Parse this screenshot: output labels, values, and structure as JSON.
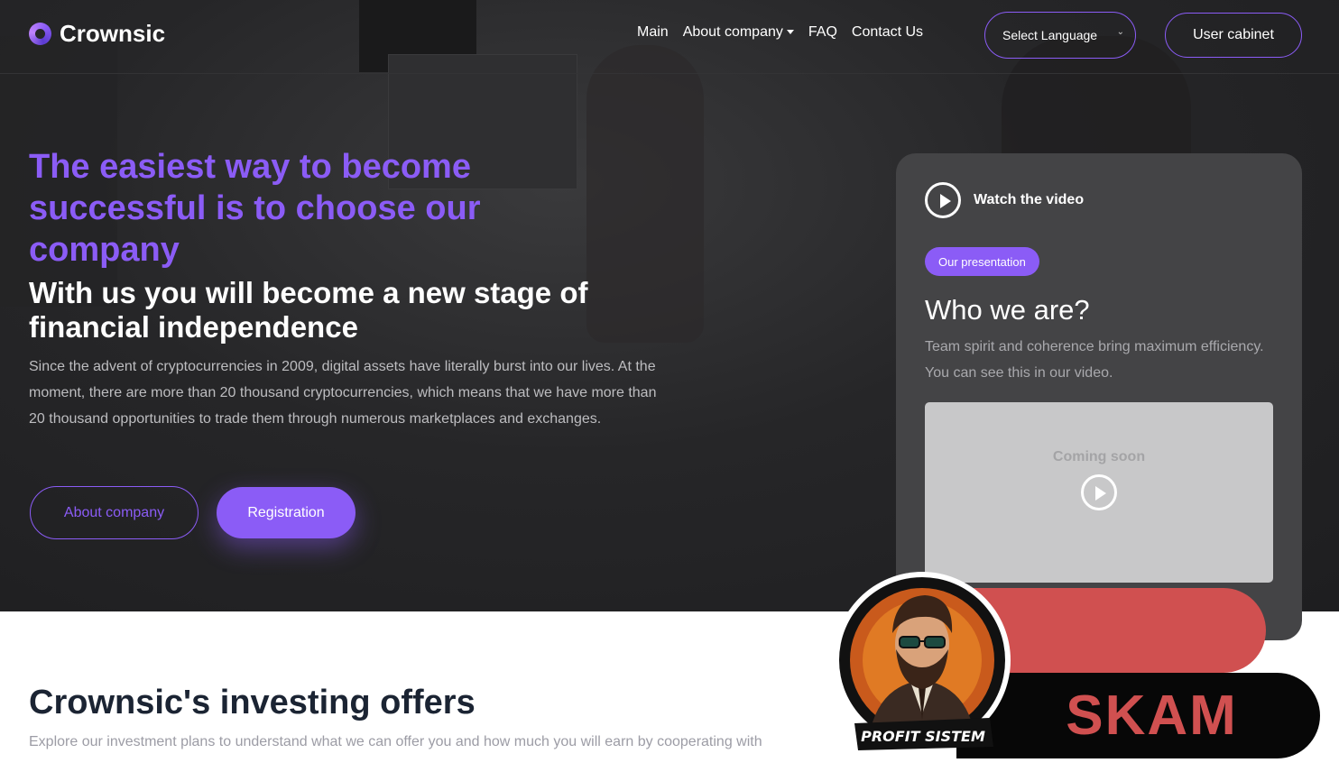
{
  "header": {
    "logo_text": "Crownsic",
    "nav": [
      {
        "label": "Main"
      },
      {
        "label": "About company",
        "dropdown": true
      },
      {
        "label": "FAQ"
      },
      {
        "label": "Contact Us"
      }
    ],
    "language_select": "Select Language",
    "cabinet_button": "User cabinet"
  },
  "hero": {
    "title": "The easiest way to become successful is to choose our company",
    "subtitle": "With us you will become a new stage of financial independence",
    "description": "Since the advent of cryptocurrencies in 2009, digital assets have literally burst into our lives. At the moment, there are more than 20 thousand cryptocurrencies, which means that we have more than 20 thousand opportunities to trade them through numerous marketplaces and exchanges.",
    "about_button": "About company",
    "registration_button": "Registration"
  },
  "video_card": {
    "watch_label": "Watch the video",
    "badge": "Our presentation",
    "heading": "Who we are?",
    "text": "Team spirit and coherence bring maximum efficiency. You can see this in our video.",
    "placeholder": "Coming soon"
  },
  "offers": {
    "title": "Crownsic's investing offers",
    "description": "Explore our investment plans to understand what we can offer you and how much you will earn by cooperating with"
  },
  "overlay": {
    "skam_text": "SKAM",
    "badge_caption": "PROFIT SISTEM"
  },
  "colors": {
    "accent": "#8b5cf6",
    "hero_bg": "#262628",
    "scam_red": "#d05050"
  }
}
